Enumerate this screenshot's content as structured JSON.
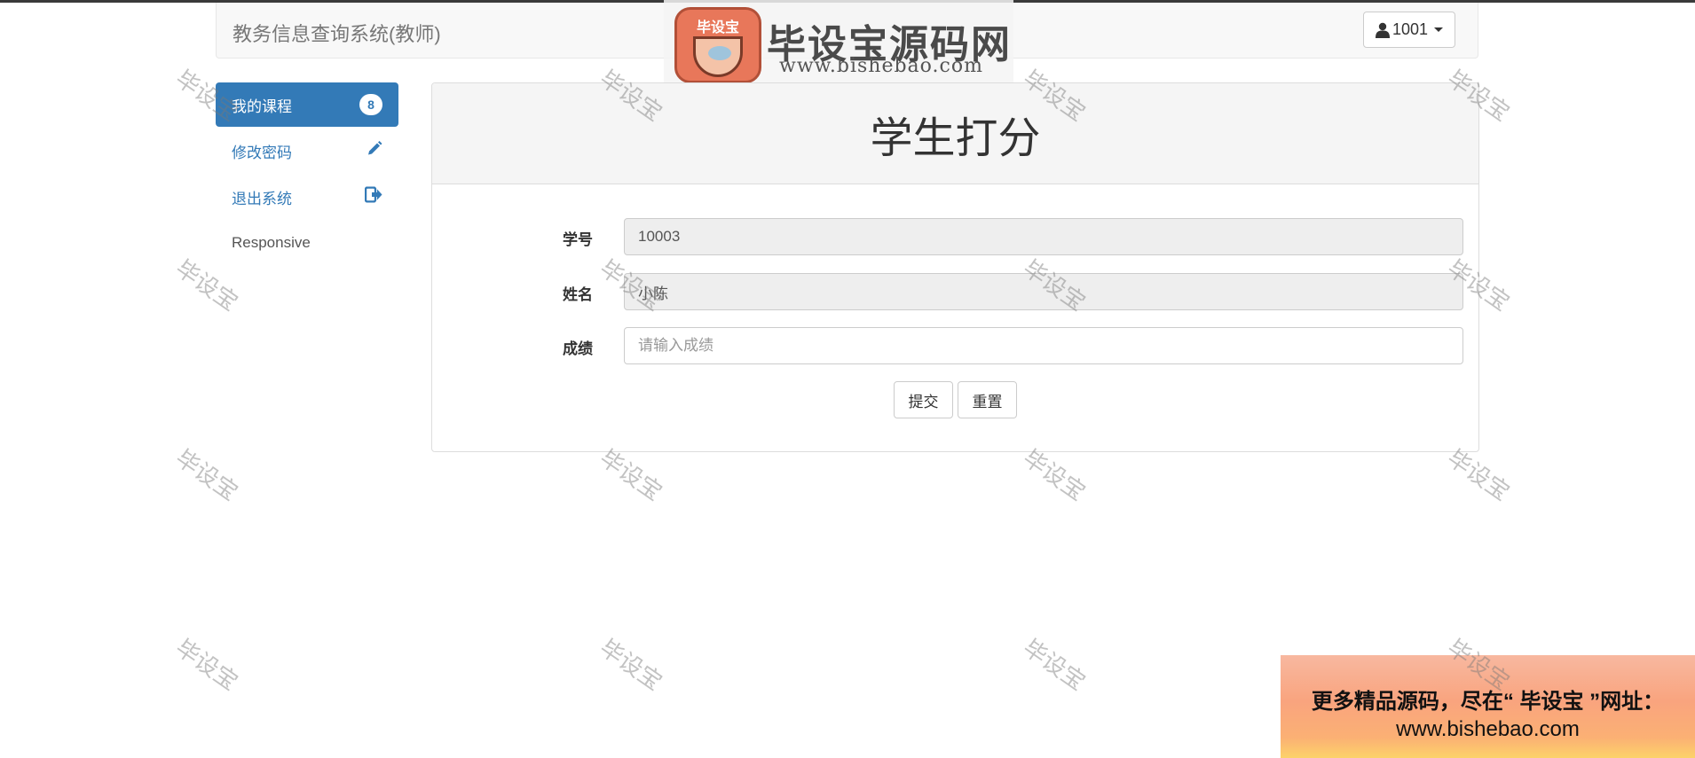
{
  "navbar": {
    "brand": "教务信息查询系统(教师)",
    "user_label": "1001"
  },
  "logo": {
    "badge_text": "毕设宝",
    "title": "毕设宝源码网",
    "url": "www.bishebao.com"
  },
  "sidebar": {
    "items": [
      {
        "label": "我的课程",
        "badge": "8",
        "active": true
      },
      {
        "label": "修改密码",
        "icon": "pencil-icon"
      },
      {
        "label": "退出系统",
        "icon": "logout-icon"
      }
    ],
    "footer_text": "Responsive"
  },
  "panel": {
    "title": "学生打分",
    "fields": {
      "student_id": {
        "label": "学号",
        "value": "10003"
      },
      "name": {
        "label": "姓名",
        "value": "小陈"
      },
      "score": {
        "label": "成绩",
        "value": "",
        "placeholder": "请输入成绩"
      }
    },
    "submit_label": "提交",
    "reset_label": "重置"
  },
  "watermark_text": "毕设宝",
  "ad": {
    "line1": "更多精品源码，尽在“ 毕设宝 ”网址：",
    "line2": "www.bishebao.com"
  },
  "colors": {
    "primary": "#337ab7",
    "panel_header_bg": "#f5f5f5",
    "navbar_bg": "#f8f8f8"
  }
}
